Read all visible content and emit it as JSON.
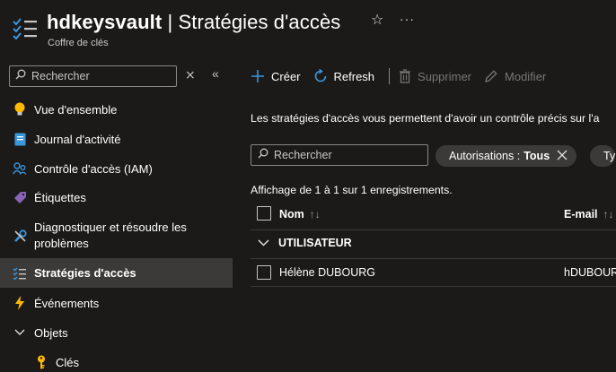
{
  "header": {
    "resource_name": "hdkeysvault",
    "separator": " | ",
    "page_title": "Stratégies d'accès",
    "subtitle": "Coffre de clés",
    "star_glyph": "☆",
    "more_glyph": "···"
  },
  "sidebar": {
    "search_placeholder": "Rechercher",
    "close_glyph": "⨯",
    "collapse_glyph": "«",
    "items": [
      {
        "label": "Vue d'ensemble",
        "icon": "lightbulb-icon"
      },
      {
        "label": "Journal d'activité",
        "icon": "activity-log-icon"
      },
      {
        "label": "Contrôle d'accès (IAM)",
        "icon": "people-icon"
      },
      {
        "label": "Étiquettes",
        "icon": "tag-icon"
      },
      {
        "label": "Diagnostiquer et résoudre les problèmes",
        "icon": "wrench-icon"
      },
      {
        "label": "Stratégies d'accès",
        "icon": "policy-list-icon"
      },
      {
        "label": "Événements",
        "icon": "lightning-icon"
      },
      {
        "label": "Objets",
        "icon": "chevron-down-icon"
      },
      {
        "label": "Clés",
        "icon": "key-icon"
      }
    ]
  },
  "toolbar": {
    "create_label": "Créer",
    "refresh_label": "Refresh",
    "delete_label": "Supprimer",
    "edit_label": "Modifier"
  },
  "main": {
    "description": "Les stratégies d'accès vous permettent d'avoir un contrôle précis sur l'a",
    "search_placeholder": "Rechercher",
    "filter_label": "Autorisations :",
    "filter_value": "Tous",
    "filter_type_label": "Ty",
    "record_count": "Affichage de 1 à 1 sur 1 enregistrements.",
    "columns": {
      "name": "Nom",
      "email": "E-mail",
      "sort_glyph": "↑↓"
    },
    "group_label": "UTILISATEUR",
    "rows": [
      {
        "name": "Hélène DUBOURG",
        "email": "hDUBOUR"
      }
    ]
  },
  "colors": {
    "background": "#1b1a19",
    "active_item": "#3b3a39",
    "accent_blue": "#3a96dd"
  }
}
